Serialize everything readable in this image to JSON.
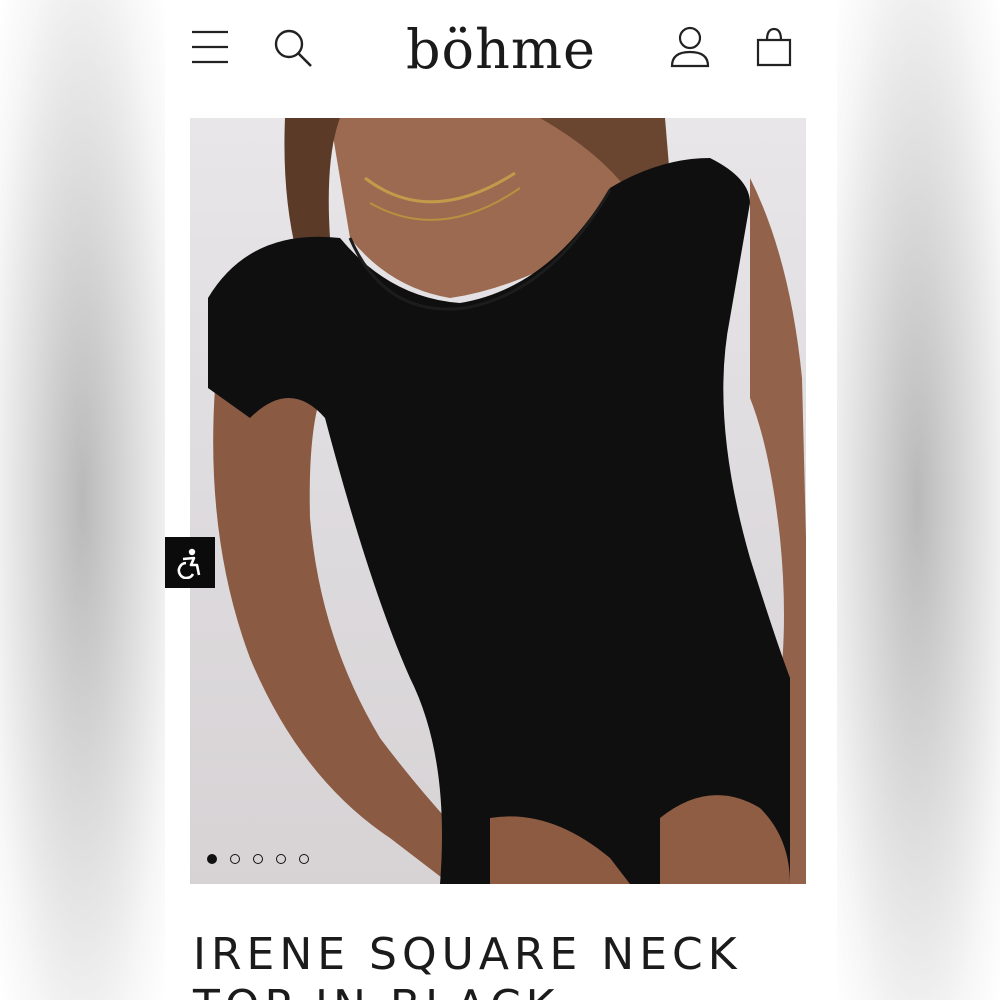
{
  "header": {
    "brand": "böhme",
    "icons": [
      "menu-icon",
      "search-icon",
      "account-icon",
      "shopping-bag-icon"
    ]
  },
  "product": {
    "title": "IRENE SQUARE NECK TOP IN BLACK",
    "image_description_colors": {
      "top": "#111111",
      "background": "#e3e1e3"
    }
  },
  "carousel": {
    "slide_count": 5,
    "active_index": 0
  },
  "accessibility": {
    "icon": "accessibility-icon"
  }
}
